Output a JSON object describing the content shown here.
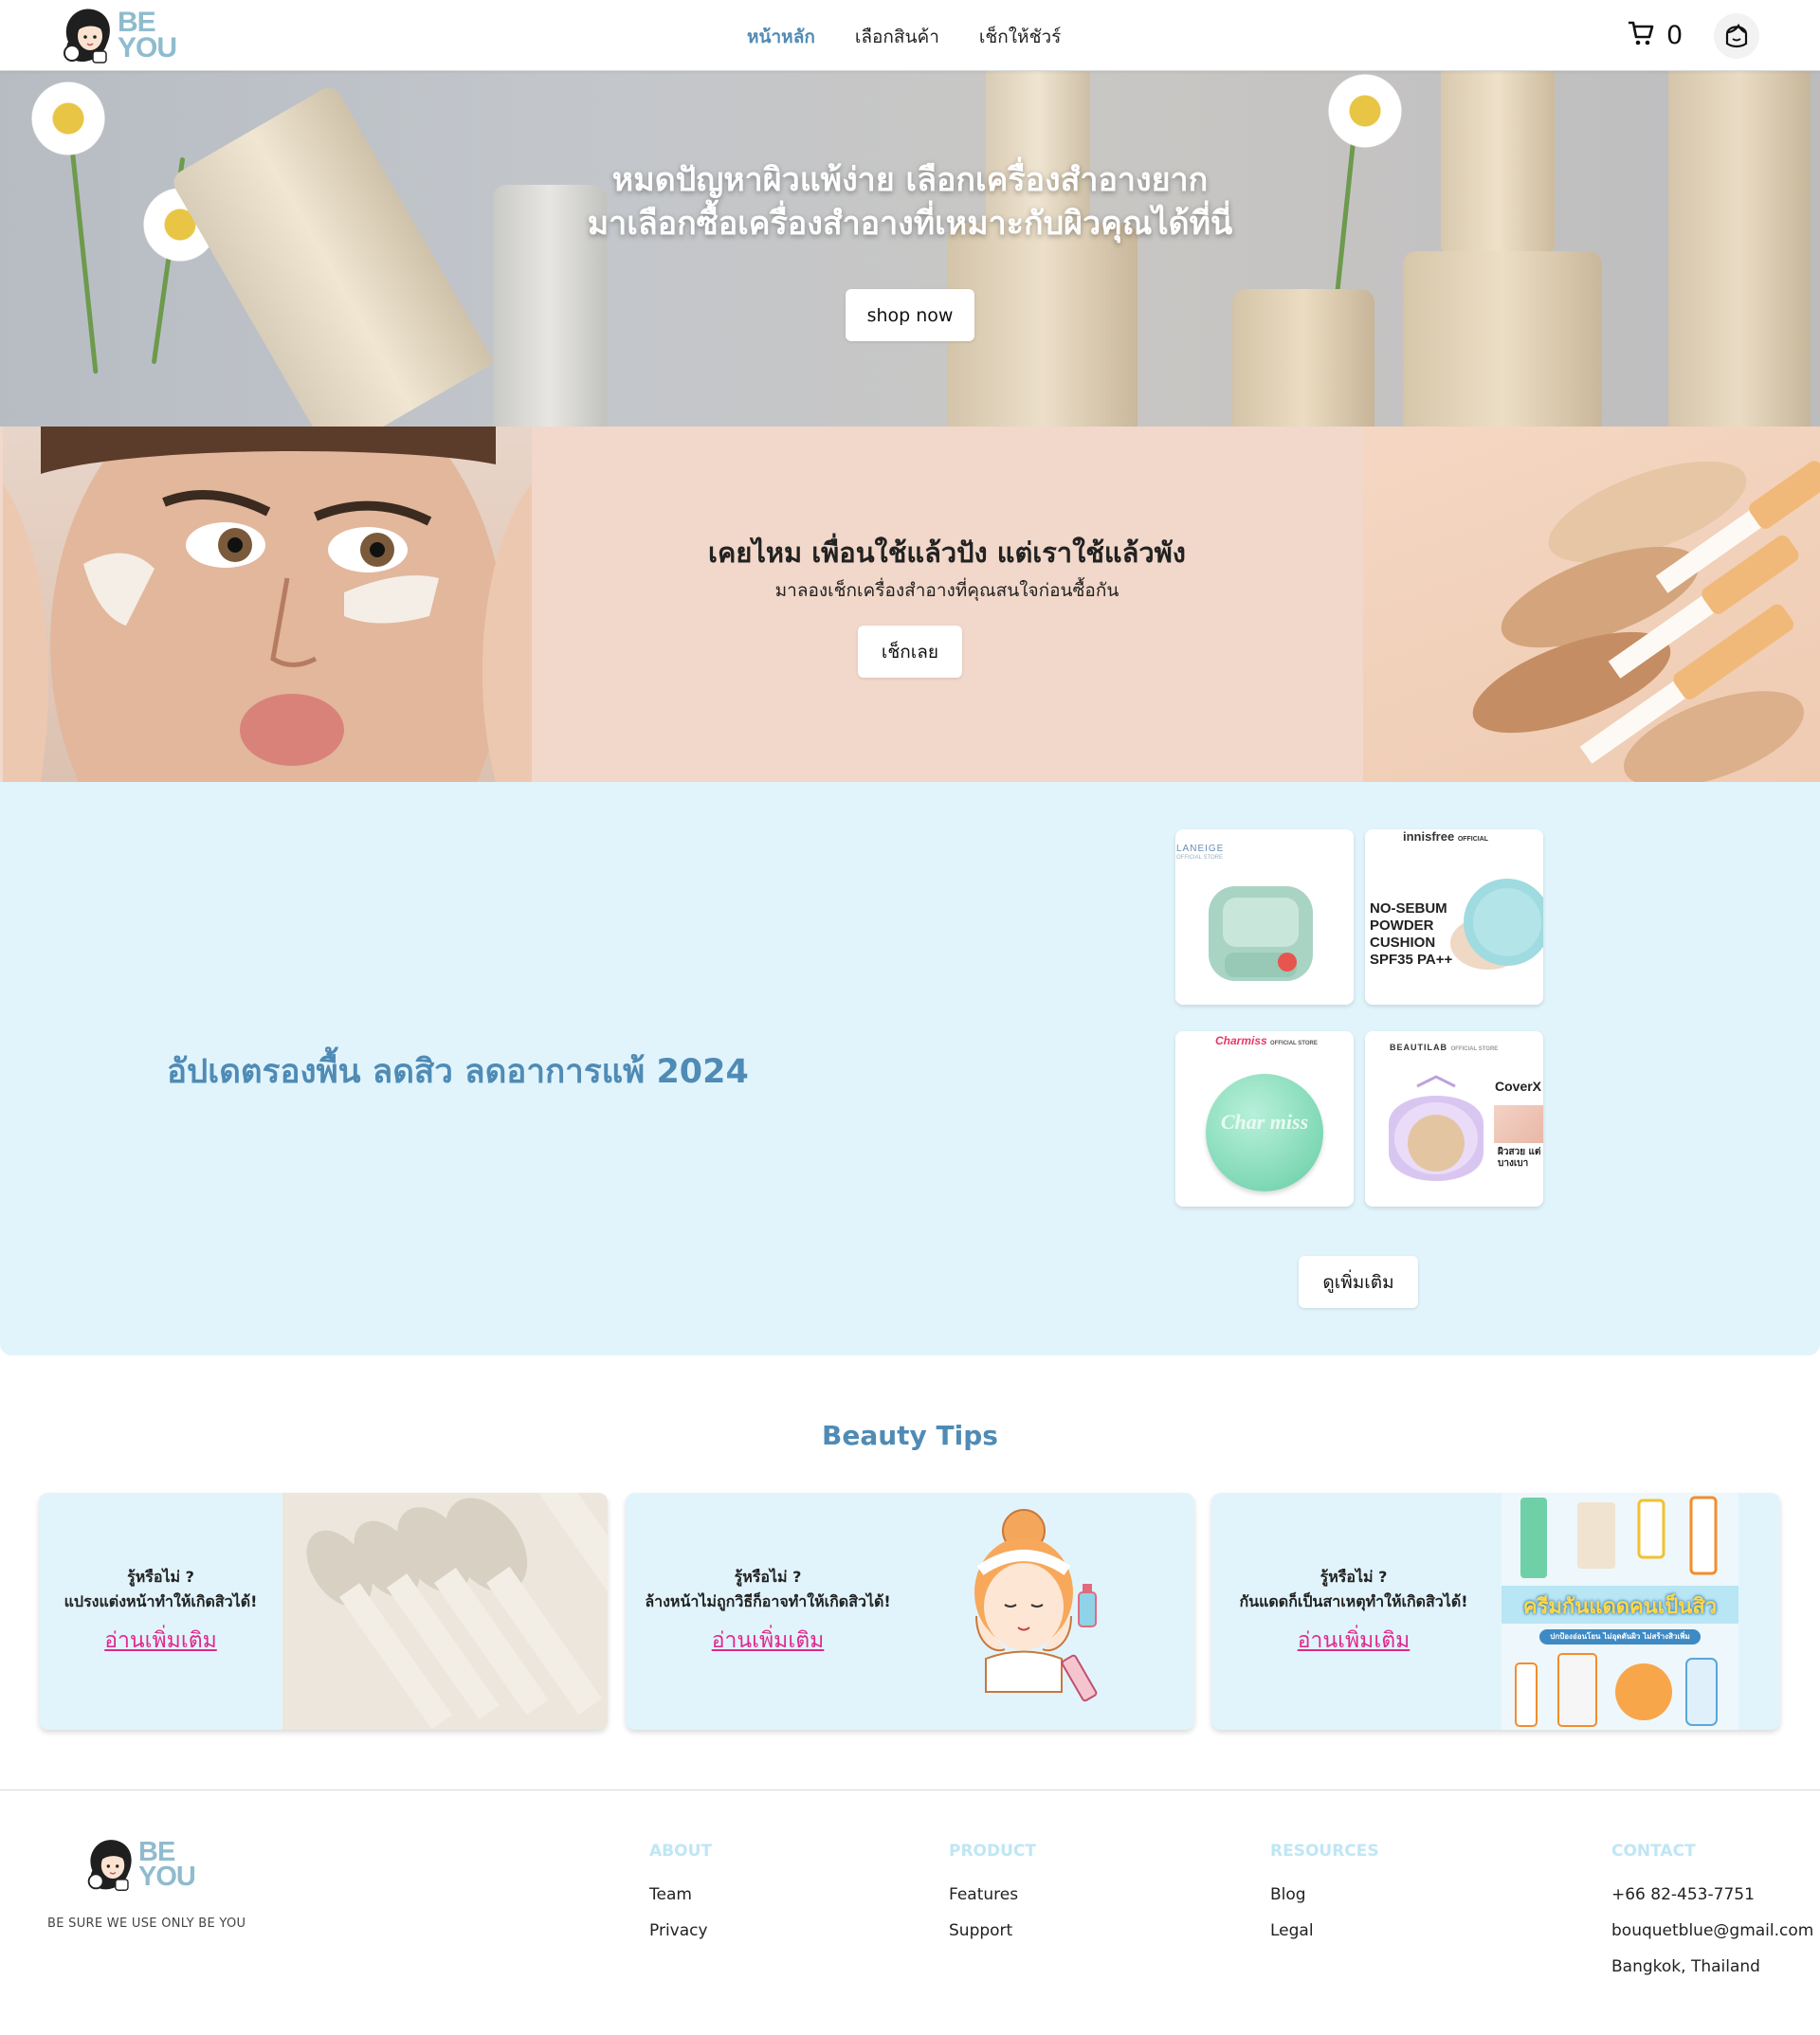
{
  "brand": {
    "logo_line1": "BE",
    "logo_line2": "YOU",
    "tagline": "BE SURE WE USE ONLY BE YOU"
  },
  "nav": {
    "items": [
      {
        "label": "หน้าหลัก",
        "active": true
      },
      {
        "label": "เลือกสินค้า",
        "active": false
      },
      {
        "label": "เช็กให้ชัวร์",
        "active": false
      }
    ],
    "cart_count": "0"
  },
  "hero": {
    "line1": "หมดปัญหาผิวแพ้ง่าย เลือกเครื่องสำอางยาก",
    "line2": "มาเลือกซื้อเครื่องสำอางที่เหมาะกับผิวคุณได้ที่นี่",
    "cta": "shop now"
  },
  "promo": {
    "title": "เคยไหม เพื่อนใช้แล้วปัง แต่เราใช้แล้วพัง",
    "subtitle": "มาลองเช็กเครื่องสำอางที่คุณสนใจก่อนซื้อกัน",
    "cta": "เช็กเลย"
  },
  "update": {
    "title": "อัปเดตรองพื้น ลดสิว ลดอาการแพ้ 2024",
    "more": "ดูเพิ่มเติม",
    "products": [
      {
        "brand": "LANEIGE",
        "store": "OFFICIAL STORE",
        "product_text": "LANEIGE"
      },
      {
        "brand": "innisfree",
        "store": "OFFICIAL",
        "product_text": "NO-SEBUM POWDER CUSHION SPF35 PA++"
      },
      {
        "brand": "Charmiss",
        "store": "OFFICIAL STORE",
        "product_text": "Char miss"
      },
      {
        "brand": "BEAUTILAB",
        "store": "OFFICIAL STORE",
        "product_text": "CoverX",
        "extra": "ผิวสวย แต่บางเบา"
      }
    ]
  },
  "tips": {
    "title": "Beauty Tips",
    "cards": [
      {
        "q1": "รู้หรือไม่ ?",
        "q2": "แปรงแต่งหน้าทำให้เกิดสิวได้!",
        "link": "อ่านเพิ่มเติม"
      },
      {
        "q1": "รู้หรือไม่ ?",
        "q2": "ล้างหน้าไม่ถูกวิธีก็อาจทำให้เกิดสิวได้!",
        "link": "อ่านเพิ่มเติม"
      },
      {
        "q1": "รู้หรือไม่ ?",
        "q2": "กันแดดก็เป็นสาเหตุทำให้เกิดสิวได้!",
        "link": "อ่านเพิ่มเติม",
        "img_title": "ครีมกันแดดคนเป็นสิว",
        "img_sub": "ปกป้องอ่อนโยน ไม่อุดตันผิว ไม่สร้างสิวเพิ่ม"
      }
    ]
  },
  "footer": {
    "about": {
      "title": "ABOUT",
      "links": [
        "Team",
        "Privacy"
      ]
    },
    "product": {
      "title": "PRODUCT",
      "links": [
        "Features",
        "Support"
      ]
    },
    "resources": {
      "title": "RESOURCES",
      "links": [
        "Blog",
        "Legal"
      ]
    },
    "contact": {
      "title": "CONTACT",
      "lines": [
        "+66 82-453-7751",
        "bouquetblue@gmail.com",
        "Bangkok, Thailand"
      ]
    }
  },
  "colors": {
    "accent_blue": "#4f8bb5",
    "logo_blue": "#8fbccd",
    "light_blue_bg": "#e1f4fc",
    "peach_bg": "#f1d8ca",
    "link_pink": "#e0288c",
    "footer_head": "#bfe6f5"
  },
  "icons": [
    "cart-icon",
    "user-face-icon"
  ]
}
